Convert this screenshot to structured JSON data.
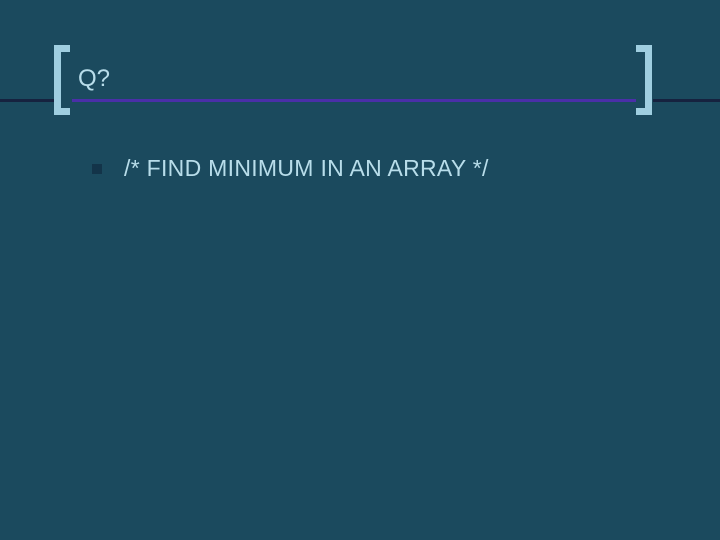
{
  "title": "Q?",
  "content": {
    "bullet_text": "/* FIND MINIMUM IN AN ARRAY */"
  }
}
